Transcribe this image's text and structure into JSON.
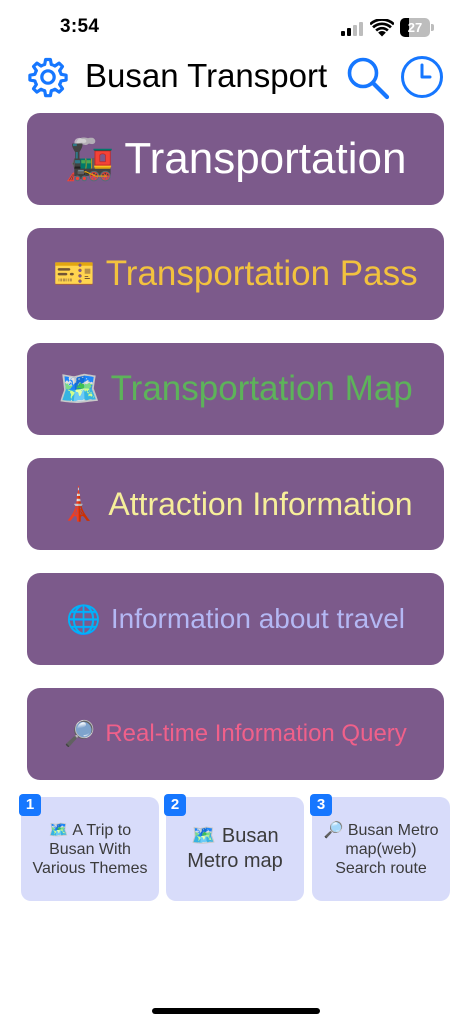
{
  "status_bar": {
    "time": "3:54",
    "battery": "27"
  },
  "nav": {
    "title": "Busan Transport",
    "icons": {
      "settings": "gear-icon",
      "search": "search-icon",
      "history": "clock-icon"
    },
    "accent_color": "#1677ff"
  },
  "menu": {
    "button_color": "#7c5a8b",
    "items": [
      {
        "emoji": "🚂",
        "label": "Transportation",
        "color": "#ffffff"
      },
      {
        "emoji": "🎫",
        "label": "Transportation Pass",
        "color": "#f2c23e"
      },
      {
        "emoji": "🗺️",
        "label": "Transportation Map",
        "color": "#5db35a"
      },
      {
        "emoji": "🗼",
        "label": "Attraction Information",
        "color": "#f6ee9a"
      },
      {
        "emoji": "🌐",
        "label": "Information about travel",
        "color": "#b4b8f4"
      },
      {
        "emoji": "🔎",
        "label": "Real-time Information Query",
        "color": "#f0608a"
      }
    ]
  },
  "bottom_cards": [
    {
      "number": "1",
      "emoji": "🗺️",
      "label": "A Trip to Busan With Various Themes"
    },
    {
      "number": "2",
      "emoji": "🗺️",
      "label": "Busan Metro map"
    },
    {
      "number": "3",
      "emoji": "🔎",
      "label": "Busan Metro map(web) Search route"
    }
  ]
}
